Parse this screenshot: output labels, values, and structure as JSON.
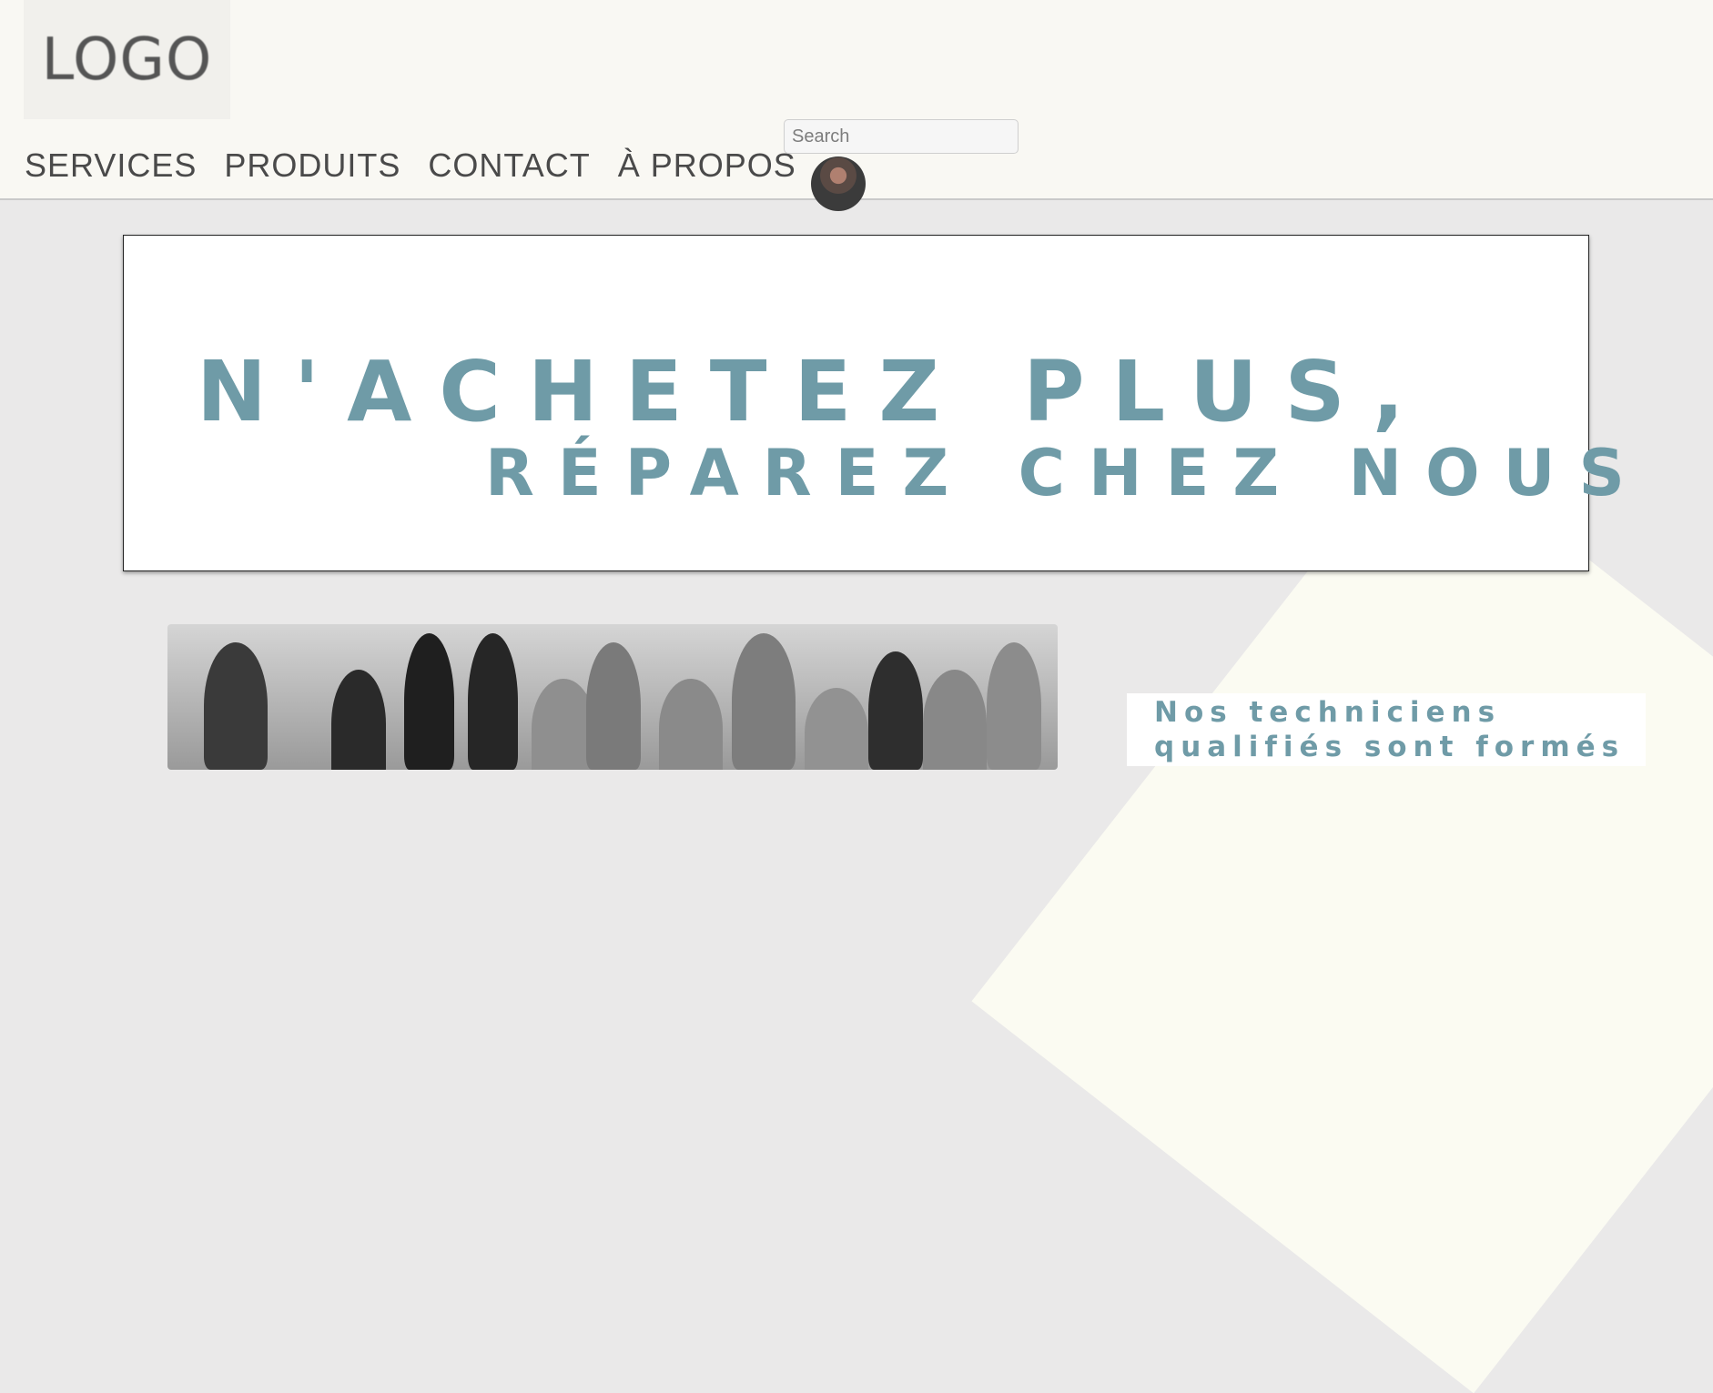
{
  "header": {
    "logo_text": "LOGO",
    "nav": [
      {
        "label": "SERVICES"
      },
      {
        "label": "PRODUITS"
      },
      {
        "label": "CONTACT"
      },
      {
        "label": "À PROPOS"
      }
    ],
    "search": {
      "placeholder": "Search",
      "value": ""
    }
  },
  "hero": {
    "line1": "N'ACHETEZ PLUS,",
    "line2": "RÉPAREZ CHEZ NOUS"
  },
  "info": {
    "text": "Nos techniciens qualifiés sont formés"
  },
  "colors": {
    "accent": "#6f9ba7",
    "header_bg": "#f9f8f3",
    "page_bg": "#eae9e9"
  }
}
